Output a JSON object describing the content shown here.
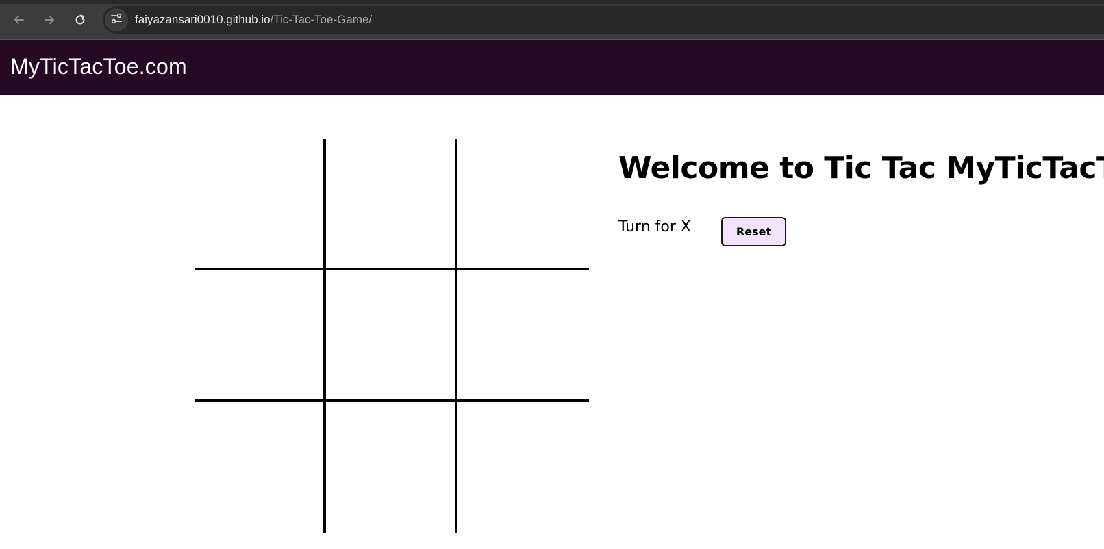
{
  "browser": {
    "url_domain": "faiyazansari0010.github.io",
    "url_path": "/Tic-Tac-Toe-Game/",
    "icons": {
      "back": "arrow-left-icon",
      "forward": "arrow-right-icon",
      "reload": "reload-icon",
      "site_info": "tune-icon"
    }
  },
  "site": {
    "brand": "MyTicTacToe.com",
    "nav_color": "#260a25"
  },
  "game": {
    "cells": [
      "",
      "",
      "",
      "",
      "",
      "",
      "",
      "",
      ""
    ]
  },
  "info": {
    "heading": "Welcome to Tic Tac MyTicTacToe",
    "turn_text": "Turn for X",
    "reset_label": "Reset",
    "reset_color": "#f3e3fa"
  }
}
